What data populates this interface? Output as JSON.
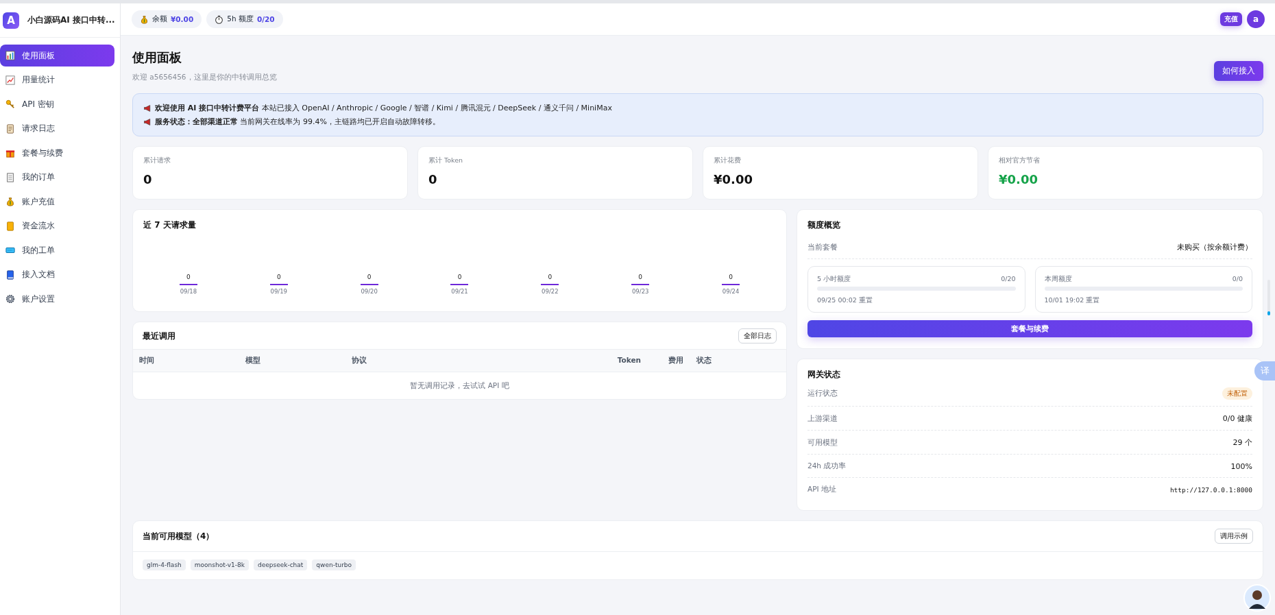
{
  "sidebar": {
    "brand_mark": "A",
    "brand": "小白源码AI 接口中转...",
    "items": [
      {
        "label": "使用面板",
        "selected": true
      },
      {
        "label": "用量统计",
        "selected": false
      },
      {
        "label": "API 密钥",
        "selected": false
      },
      {
        "label": "请求日志",
        "selected": false
      },
      {
        "label": "套餐与续费",
        "selected": false
      },
      {
        "label": "我的订单",
        "selected": false
      },
      {
        "label": "账户充值",
        "selected": false
      },
      {
        "label": "资金流水",
        "selected": false
      },
      {
        "label": "我的工单",
        "selected": false
      },
      {
        "label": "接入文档",
        "selected": false
      },
      {
        "label": "账户设置",
        "selected": false
      }
    ]
  },
  "topbar": {
    "chips": [
      {
        "label": "余额",
        "value": "¥0.00"
      },
      {
        "label": "5h 额度",
        "value": "0/20"
      }
    ],
    "recharge_button": "充值",
    "avatar": "a"
  },
  "header": {
    "title": "使用面板",
    "subtitle": "欢迎 a5656456，这里是你的中转调用总览",
    "action": "如何接入"
  },
  "notice": [
    "**欢迎使用 AI 接口中转计费平台** 本站已接入 OpenAI / Anthropic / Google / 智谱 / Kimi / 腾讯混元 / DeepSeek / 通义千问 / MiniMax",
    "**服务状态：全部渠道正常** 当前网关在线率为 99.4%，主链路均已开启自动故障转移。"
  ],
  "stats": [
    {
      "label": "累计请求",
      "value": "0",
      "kind": "plain"
    },
    {
      "label": "累计 Token",
      "value": "0",
      "kind": "plain"
    },
    {
      "label": "累计花费",
      "value": "¥0.00",
      "kind": "plain"
    },
    {
      "label": "相对官方节省",
      "value": "¥0.00",
      "kind": "saving"
    }
  ],
  "chart_card": {
    "title": "近 7 天请求量",
    "days": [
      {
        "count": "0",
        "date": "09/18"
      },
      {
        "count": "0",
        "date": "09/19"
      },
      {
        "count": "0",
        "date": "09/20"
      },
      {
        "count": "0",
        "date": "09/21"
      },
      {
        "count": "0",
        "date": "09/22"
      },
      {
        "count": "0",
        "date": "09/23"
      },
      {
        "count": "0",
        "date": "09/24"
      }
    ]
  },
  "recent": {
    "title": "最近调用",
    "action": "全部日志",
    "columns": [
      "时间",
      "模型",
      "协议",
      "Token",
      "费用",
      "状态"
    ],
    "empty": "暂无调用记录，去试试 API 吧"
  },
  "quota": {
    "title": "额度概览",
    "plan_label": "当前套餐",
    "plan_value": "未购买（按余额计费）",
    "meters": [
      {
        "label": "5 小时额度",
        "reading": "0/20",
        "level": 0,
        "reset": "09/25 00:02 重置"
      },
      {
        "label": "本周额度",
        "reading": "0/0",
        "level": 0,
        "reset": "10/01 19:02 重置"
      }
    ],
    "button": "套餐与续费"
  },
  "gateway": {
    "title": "网关状态",
    "rows": [
      {
        "label": "运行状态",
        "value": "未配置",
        "kind": "badge"
      },
      {
        "label": "上游渠道",
        "value": "0/0 健康",
        "kind": "text"
      },
      {
        "label": "可用模型",
        "value": "29 个",
        "kind": "text"
      },
      {
        "label": "24h 成功率",
        "value": "100%",
        "kind": "text"
      },
      {
        "label": "API 地址",
        "value": "http://127.0.0.1:8000",
        "kind": "code"
      }
    ]
  },
  "models": {
    "title": "当前可用模型（4）",
    "action": "调用示例",
    "tags": [
      "glm-4-flash",
      "moonshot-v1-8k",
      "deepseek-chat",
      "qwen-turbo"
    ]
  },
  "translate_button": "译"
}
